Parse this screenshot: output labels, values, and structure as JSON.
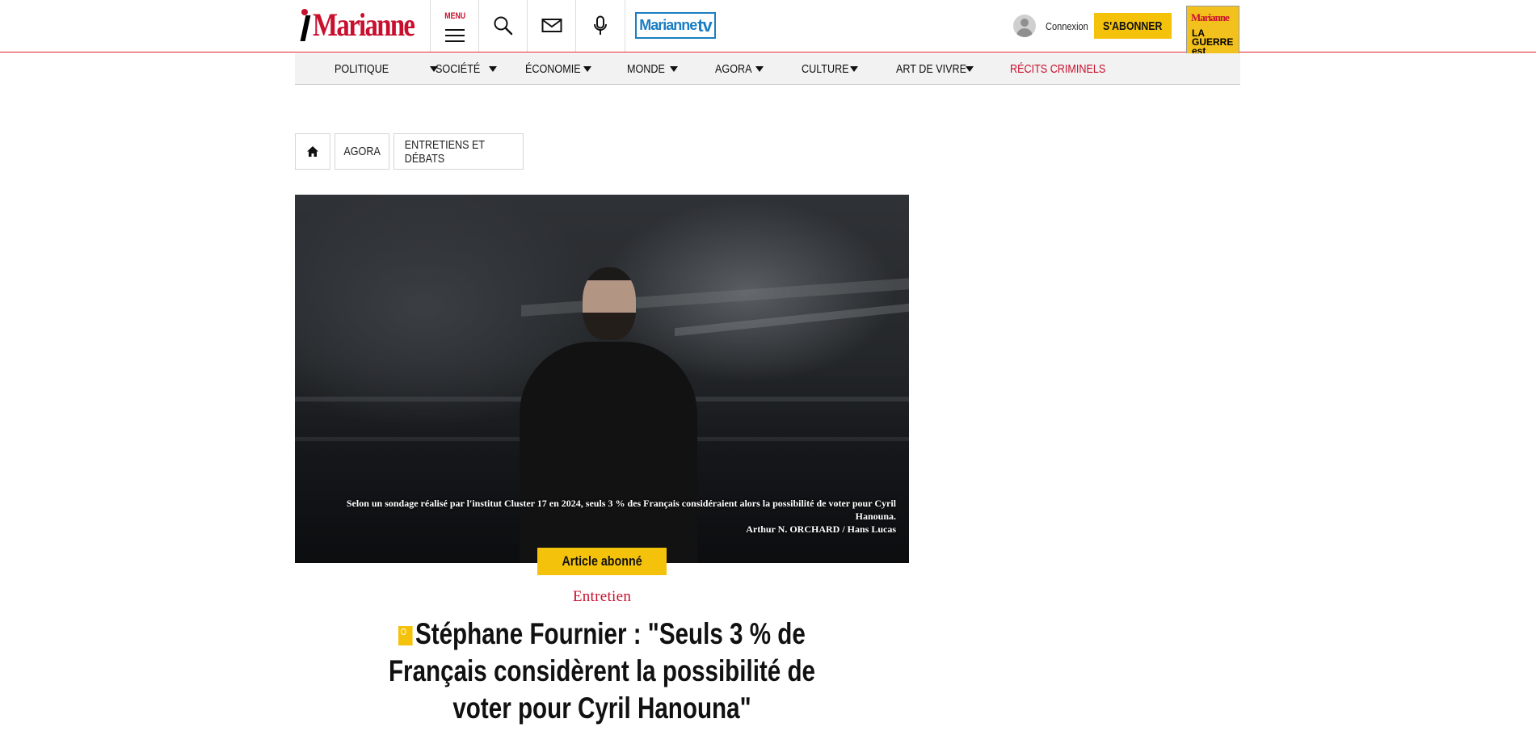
{
  "header": {
    "logo_text": "Marianne",
    "menu_label": "MENU",
    "marianne_tv_text": "Marianne",
    "marianne_tv_suffix": "tv",
    "login_label": "Connexion",
    "subscribe_label": "S'ABONNER",
    "magazine": {
      "logo": "Marianne",
      "headline": "LA GUERRE est déclarée"
    }
  },
  "nav": {
    "items": [
      {
        "label": "POLITIQUE"
      },
      {
        "label": "SOCIÉTÉ"
      },
      {
        "label": "ÉCONOMIE"
      },
      {
        "label": "MONDE"
      },
      {
        "label": "AGORA"
      },
      {
        "label": "CULTURE"
      },
      {
        "label": "ART DE VIVRE"
      },
      {
        "label": "RÉCITS CRIMINELS"
      }
    ]
  },
  "breadcrumb": {
    "items": [
      {
        "label": "AGORA"
      },
      {
        "label": "ENTRETIENS ET DÉBATS"
      }
    ]
  },
  "article": {
    "image_caption": "Selon un sondage réalisé par l'institut Cluster 17 en 2024, seuls 3 % des Français considéraient alors la possibilité de voter pour Cyril Hanouna.",
    "image_credit": "Arthur N. ORCHARD / Hans Lucas",
    "badge": "Article abonné",
    "kicker": "Entretien",
    "title": "Stéphane Fournier : \"Seuls 3 % de Français considèrent la possibilité de voter pour Cyril Hanouna\""
  },
  "colors": {
    "brand_red": "#c8102e",
    "accent_yellow": "#f5c20b",
    "tv_blue": "#1b7ec2"
  }
}
